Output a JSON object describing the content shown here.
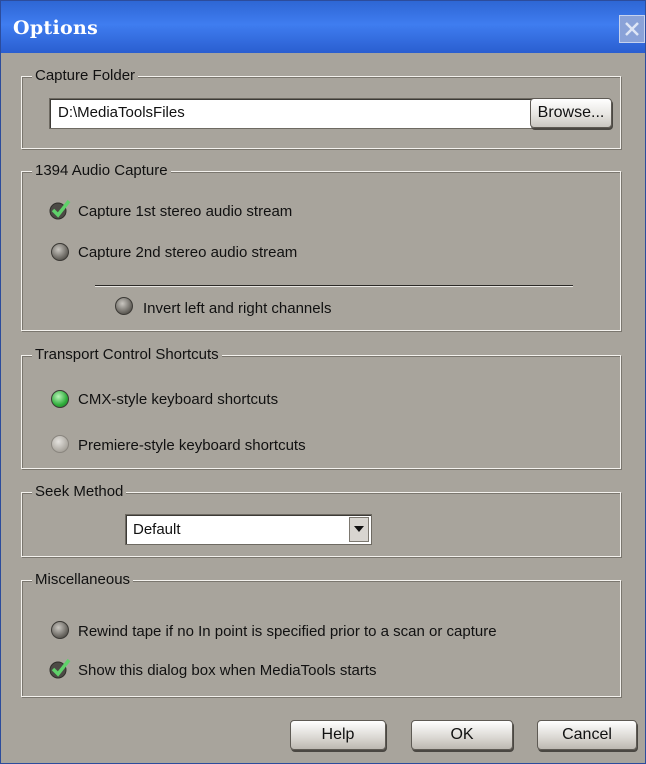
{
  "window": {
    "title": "Options",
    "close_icon": "close-icon"
  },
  "capture_folder": {
    "legend": "Capture Folder",
    "path_value": "D:\\MediaToolsFiles",
    "browse_label": "Browse..."
  },
  "audio_capture": {
    "legend": "1394 Audio Capture",
    "option1": {
      "label": "Capture 1st stereo audio stream",
      "checked": true
    },
    "option2": {
      "label": "Capture 2nd stereo audio stream",
      "checked": false
    },
    "invert": {
      "label": "Invert left and right channels",
      "checked": false
    }
  },
  "transport": {
    "legend": "Transport Control Shortcuts",
    "cmx": {
      "label": "CMX-style keyboard shortcuts",
      "selected": true
    },
    "premiere": {
      "label": "Premiere-style keyboard shortcuts",
      "selected": false
    }
  },
  "seek": {
    "legend": "Seek Method",
    "selected": "Default"
  },
  "misc": {
    "legend": "Miscellaneous",
    "rewind": {
      "label": "Rewind tape if no In point is specified prior to a scan or capture",
      "checked": false
    },
    "show_dialog": {
      "label": "Show this dialog box when MediaTools starts",
      "checked": true
    }
  },
  "footer": {
    "help_label": "Help",
    "ok_label": "OK",
    "cancel_label": "Cancel"
  },
  "colors": {
    "titlebar": "#3f7df0",
    "dialog_bg": "#a8a49c",
    "radio_selected": "#2fae3b"
  }
}
